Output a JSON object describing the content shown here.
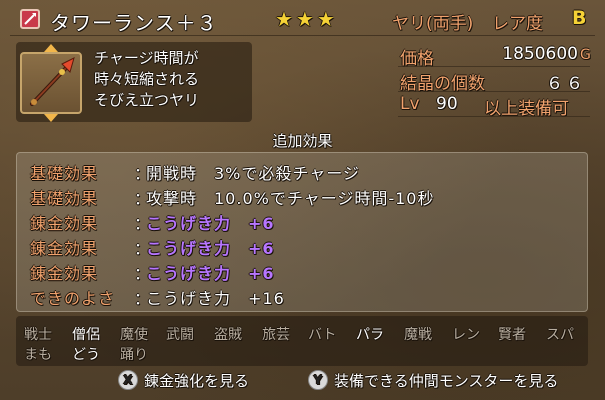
{
  "header": {
    "weapon_type_icon": "spear-icon",
    "item_name": "タワーランス＋３",
    "stars": "★★★",
    "weapon_category": "ヤリ(両手)",
    "rarity_label": "レア度",
    "rarity_value": "B"
  },
  "description": {
    "item_icon": "spear-item-icon",
    "line1": "チャージ時間が",
    "line2": "時々短縮される",
    "line3": "そびえ立つヤリ"
  },
  "stats": {
    "price_label": "価格",
    "price_value": "1850600",
    "price_unit": "G",
    "crystal_label": "結晶の個数",
    "crystal_value": "６６",
    "level_label": "Lv",
    "level_value": "90",
    "level_suffix": "以上装備可"
  },
  "effects": {
    "heading": "追加効果",
    "rows": [
      {
        "label": "基礎効果",
        "value": "開戦時　3%で必殺チャージ"
      },
      {
        "label": "基礎効果",
        "value": "攻撃時　10.0%でチャージ時間-10秒"
      },
      {
        "label": "錬金効果",
        "value": "こうげき力　+6"
      },
      {
        "label": "錬金効果",
        "value": "こうげき力　+6"
      },
      {
        "label": "錬金効果",
        "value": "こうげき力　+6"
      },
      {
        "label": "できのよさ",
        "value": "こうげき力　+16"
      }
    ]
  },
  "jobs": {
    "row1": [
      "戦士",
      "僧侶",
      "魔使",
      "武闘",
      "盗賊",
      "旅芸",
      "バト",
      "パラ",
      "魔戦",
      "レン",
      "賢者",
      "スパ"
    ],
    "row2": [
      "まも",
      "どう",
      "踊り"
    ]
  },
  "buttons": {
    "x_key": "X",
    "x_label": "錬金強化を見る",
    "y_key": "Y",
    "y_label": "装備できる仲間モンスターを見る"
  },
  "colors": {
    "label_orange": "#f0a26d",
    "star_yellow": "#f5d236",
    "purple_effect": "#b776ff"
  }
}
